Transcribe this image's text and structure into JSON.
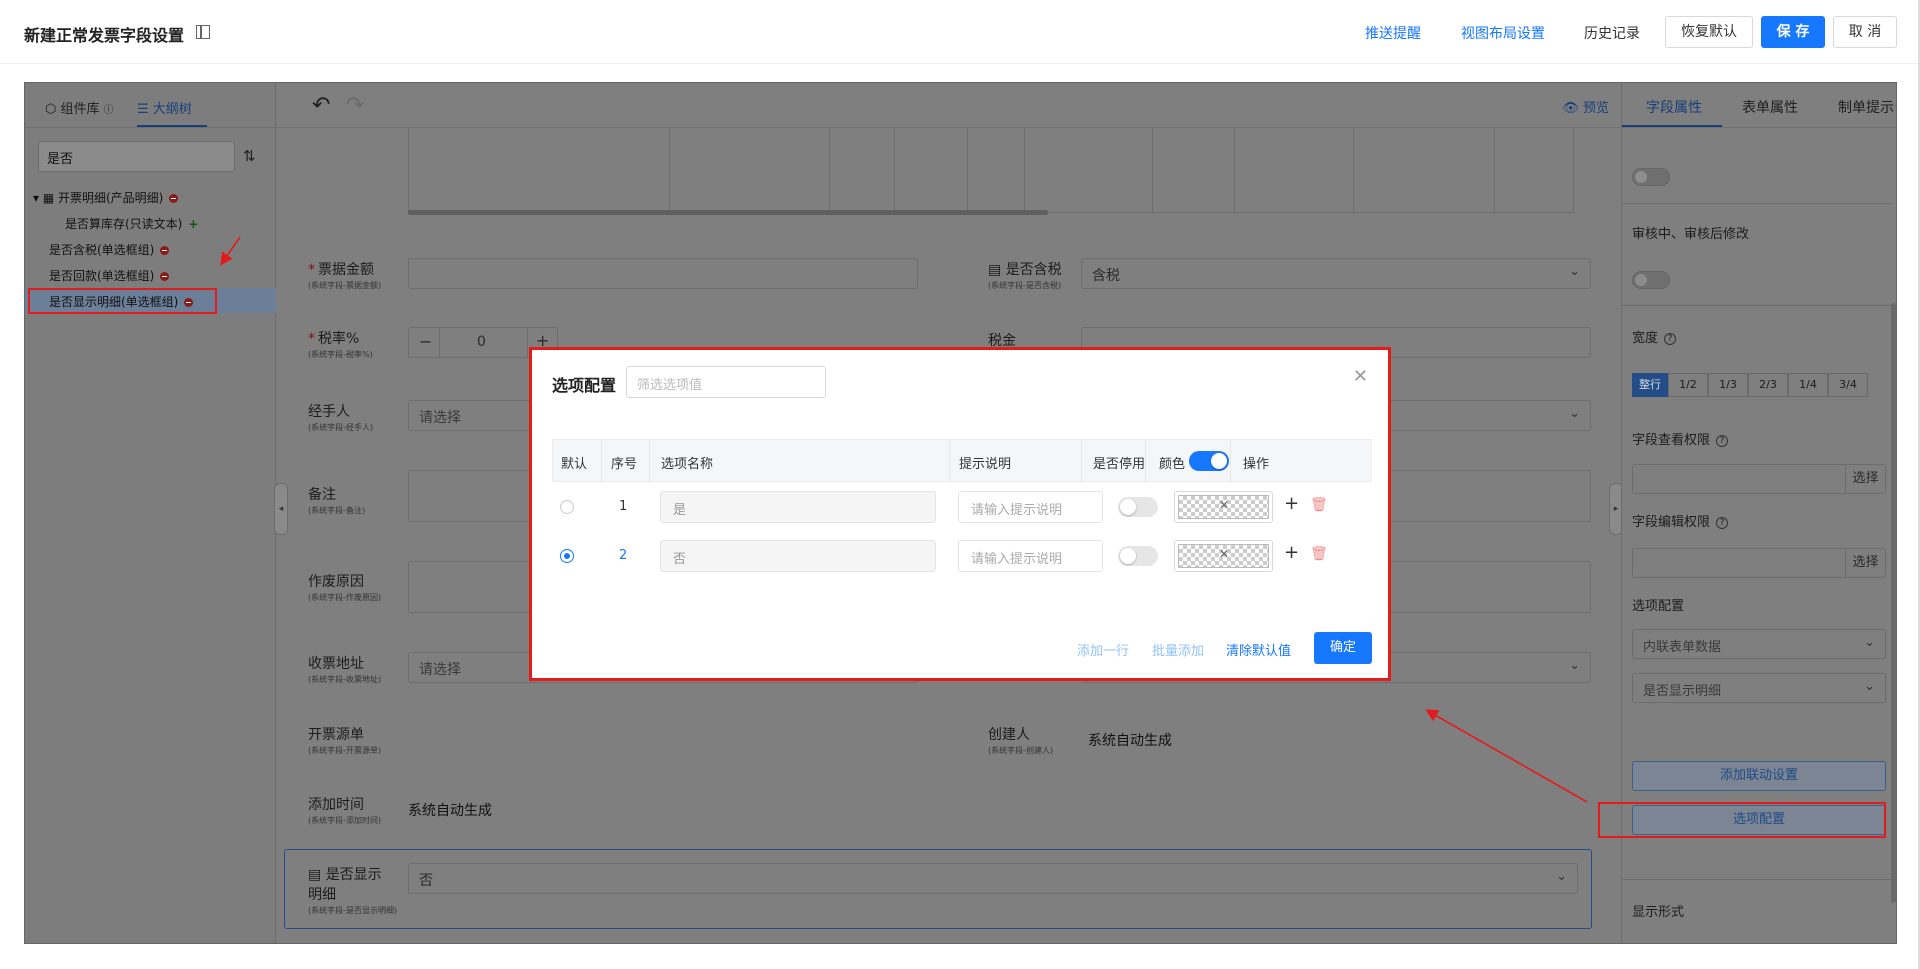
{
  "header": {
    "title": "新建正常发票字段设置",
    "links": [
      "推送提醒",
      "视图布局设置",
      "历史记录"
    ],
    "buttons": {
      "restore": "恢复默认",
      "save": "保 存",
      "cancel": "取 消"
    }
  },
  "left_panel": {
    "tabs": [
      "组件库",
      "大纲树"
    ],
    "search_value": "是否",
    "tree": [
      "开票明细(产品明细)",
      "是否算库存(只读文本)",
      "是否含税(单选框组)",
      "是否回款(单选框组)",
      "是否显示明细(单选框组)"
    ]
  },
  "center": {
    "preview": "预览",
    "fields": {
      "amount": {
        "label": "票据金额",
        "sub": "(系统字段-票据金额)"
      },
      "tax_incl": {
        "label": "是否含税",
        "sub": "(系统字段-是否含税)",
        "value": "含税"
      },
      "tax_rate": {
        "label": "税率%",
        "sub": "(系统字段-税率%)",
        "value": "0"
      },
      "tax": {
        "label": "税金"
      },
      "handler": {
        "label": "经手人",
        "sub": "(系统字段-经手人)",
        "placeholder": "请选择"
      },
      "remark": {
        "label": "备注",
        "sub": "(系统字段-备注)"
      },
      "void_reason": {
        "label": "作废原因",
        "sub": "(系统字段-作废原因)"
      },
      "address": {
        "label": "收票地址",
        "sub": "(系统字段-收票地址)",
        "placeholder": "请选择"
      },
      "source": {
        "label": "开票源单",
        "sub": "(系统字段-开票源单)"
      },
      "creator": {
        "label": "创建人",
        "sub": "(系统字段-创建人)",
        "value": "系统自动生成"
      },
      "added_time": {
        "label": "添加时间",
        "sub": "(系统字段-添加时间)",
        "value": "系统自动生成"
      },
      "show_detail": {
        "label_line1": "是否显示",
        "label_line2": "明细",
        "sub": "(系统字段-是否显示明细)",
        "value": "否"
      }
    }
  },
  "right_panel": {
    "tabs": [
      "字段属性",
      "表单属性",
      "制单提示"
    ],
    "review_label": "审核中、审核后修改",
    "width_label": "宽度",
    "width_options": [
      "整行",
      "1/2",
      "1/3",
      "2/3",
      "1/4",
      "3/4"
    ],
    "view_perm_label": "字段查看权限",
    "edit_perm_label": "字段编辑权限",
    "select_btn": "选择",
    "option_config_label": "选项配置",
    "option_source": "内联表单数据",
    "option_field": "是否显示明细",
    "linkage_btn": "添加联动设置",
    "option_config_btn": "选项配置",
    "display_label": "显示形式"
  },
  "modal": {
    "title": "选项配置",
    "filter_placeholder": "筛选选项值",
    "headers": [
      "默认",
      "序号",
      "选项名称",
      "提示说明",
      "是否停用",
      "颜色",
      "操作"
    ],
    "rows": [
      {
        "index": "1",
        "name": "是",
        "hint_placeholder": "请输入提示说明",
        "default": false
      },
      {
        "index": "2",
        "name": "否",
        "hint_placeholder": "请输入提示说明",
        "default": true
      }
    ],
    "footer": {
      "add_row": "添加一行",
      "batch_add": "批量添加",
      "clear_default": "清除默认值",
      "confirm": "确定"
    }
  },
  "colors": {
    "primary": "#1677ff",
    "annotation": "#e31b1b"
  }
}
